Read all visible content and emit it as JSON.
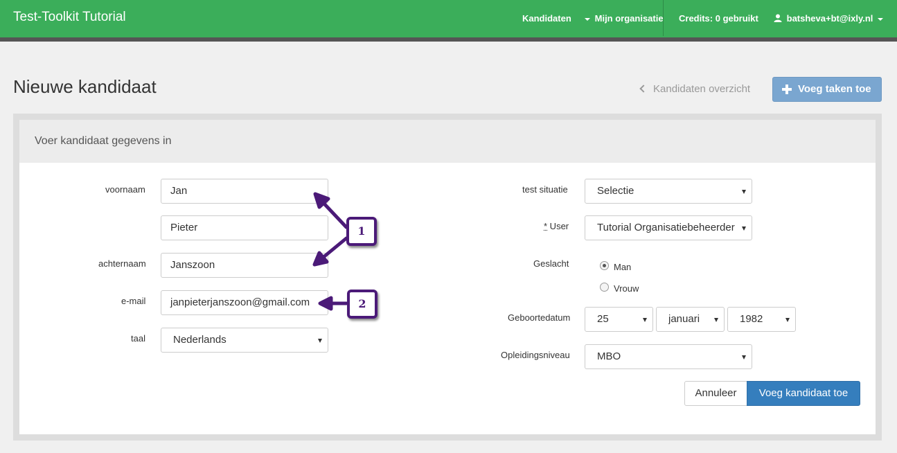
{
  "navbar": {
    "brand": "Test-Toolkit Tutorial",
    "links": {
      "candidates": "Kandidaten",
      "my_organisation": "Mijn organisatie",
      "credits": "Credits: 0 gebruikt",
      "user": "batsheva+bt@ixly.nl"
    },
    "color": "#3bae5a"
  },
  "header": {
    "title": "Nieuwe kandidaat",
    "back_link": "Kandidaten overzicht",
    "add_tasks_button": "Voeg taken toe"
  },
  "panel": {
    "heading": "Voer kandidaat gegevens in"
  },
  "form_left": {
    "first_name_label": "voornaam",
    "first_name_value": "Jan",
    "middle_name_value": "Pieter",
    "last_name_label": "achternaam",
    "last_name_value": "Janszoon",
    "email_label": "e-mail",
    "email_value": "janpieterjanszoon@gmail.com",
    "language_label": "taal",
    "language_value": "Nederlands"
  },
  "form_right": {
    "test_situation_label": "test situatie",
    "test_situation_value": "Selectie",
    "user_label_star": "*",
    "user_label": " User",
    "user_value": "Tutorial Organisatiebeheerder",
    "gender_label": "Geslacht",
    "gender_options": [
      "Man",
      "Vrouw"
    ],
    "gender_selected": "Man",
    "birthdate_label": "Geboortedatum",
    "birth_day": "25",
    "birth_month": "januari",
    "birth_year": "1982",
    "education_label": "Opleidingsniveau",
    "education_value": "MBO"
  },
  "actions": {
    "cancel": "Annuleer",
    "submit": "Voeg kandidaat toe"
  },
  "annotations": {
    "one": "1",
    "two": "2",
    "color": "#4b1a78"
  },
  "icons": {
    "user": "user-icon",
    "plus": "plus-icon",
    "back": "chevron-left-icon",
    "caret": "caret-down-icon"
  }
}
